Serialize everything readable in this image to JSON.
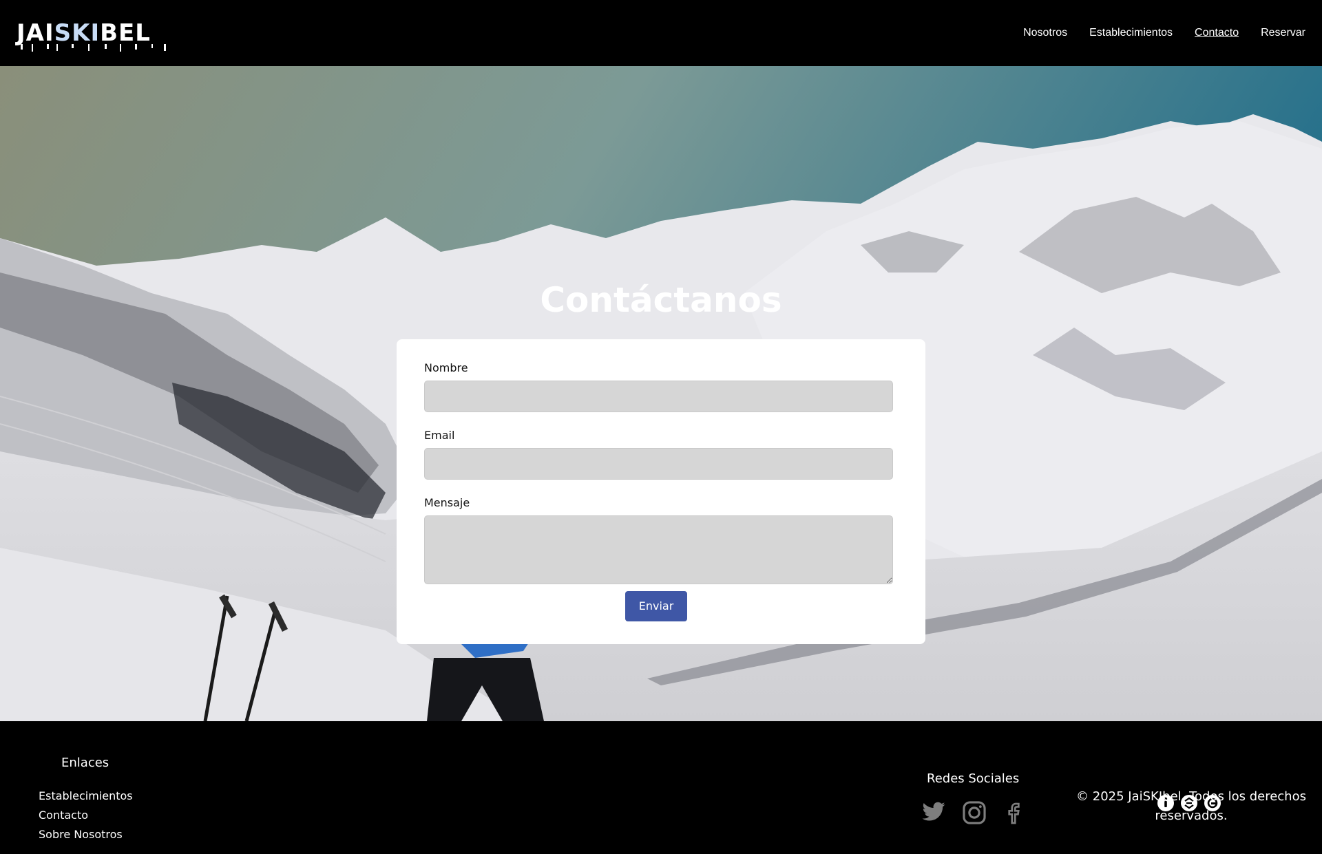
{
  "header": {
    "logo_text_a": "JAI",
    "logo_text_b": "SKI",
    "logo_text_c": "BEL",
    "nav": [
      {
        "label": "Nosotros"
      },
      {
        "label": "Establecimientos"
      },
      {
        "label": "Contacto",
        "active": true
      },
      {
        "label": "Reservar"
      }
    ]
  },
  "hero": {
    "title": "Contáctanos"
  },
  "form": {
    "name_label": "Nombre",
    "email_label": "Email",
    "message_label": "Mensaje",
    "submit_label": "Enviar"
  },
  "footer": {
    "links_title": "Enlaces",
    "links": [
      "Establecimientos",
      "Contacto",
      "Sobre Nosotros"
    ],
    "social_title": "Redes Sociales",
    "social_icons": [
      "twitter-icon",
      "instagram-icon",
      "facebook-icon"
    ],
    "badge_icons": [
      "accessibility-icon",
      "recycle-icon",
      "sustainability-icon"
    ],
    "copyright": "© 2025 JaiSKIbel. Todos los derechos reservados."
  },
  "colors": {
    "header_bg": "#000000",
    "button": "#3f57a6",
    "input_bg": "#d6d6d6"
  }
}
